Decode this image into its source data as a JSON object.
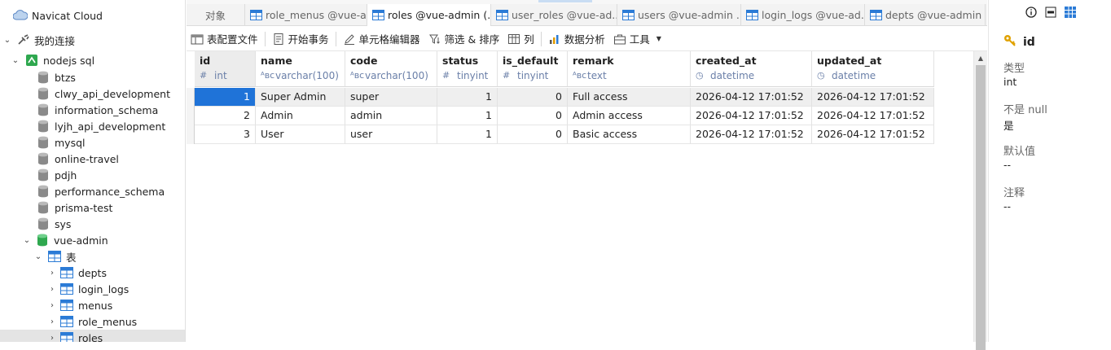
{
  "sidebar": {
    "app_title": "Navicat Cloud",
    "my_connections": "我的连接",
    "connection": "nodejs sql",
    "databases": [
      "btzs",
      "clwy_api_development",
      "information_schema",
      "lyjh_api_development",
      "mysql",
      "online-travel",
      "pdjh",
      "performance_schema",
      "prisma-test",
      "sys"
    ],
    "open_database": "vue-admin",
    "tables_folder": "表",
    "tables": [
      "depts",
      "login_logs",
      "menus",
      "role_menus",
      "roles"
    ]
  },
  "tabs": [
    {
      "label": "对象",
      "active": false,
      "icon": false
    },
    {
      "label": "role_menus @vue-a...",
      "active": false,
      "icon": true
    },
    {
      "label": "roles @vue-admin (...",
      "active": true,
      "icon": true
    },
    {
      "label": "user_roles @vue-ad...",
      "active": false,
      "icon": true
    },
    {
      "label": "users @vue-admin ...",
      "active": false,
      "icon": true
    },
    {
      "label": "login_logs @vue-ad...",
      "active": false,
      "icon": true
    },
    {
      "label": "depts @vue-admin ...",
      "active": false,
      "icon": true
    }
  ],
  "toolbar": {
    "table_config_file": "表配置文件",
    "begin_transaction": "开始事务",
    "cell_editor": "单元格编辑器",
    "filter_sort": "筛选 & 排序",
    "columns": "列",
    "data_analysis": "数据分析",
    "tools": "工具"
  },
  "grid": {
    "columns": [
      {
        "name": "id",
        "type": "int",
        "kind": "num"
      },
      {
        "name": "name",
        "type": "varchar(100)",
        "kind": "text"
      },
      {
        "name": "code",
        "type": "varchar(100)",
        "kind": "text"
      },
      {
        "name": "status",
        "type": "tinyint",
        "kind": "num"
      },
      {
        "name": "is_default",
        "type": "tinyint",
        "kind": "num"
      },
      {
        "name": "remark",
        "type": "text",
        "kind": "text"
      },
      {
        "name": "created_at",
        "type": "datetime",
        "kind": "date"
      },
      {
        "name": "updated_at",
        "type": "datetime",
        "kind": "date"
      }
    ],
    "rows": [
      [
        "1",
        "Super Admin",
        "super",
        "1",
        "0",
        "Full access",
        "2026-04-12 17:01:52",
        "2026-04-12 17:01:52"
      ],
      [
        "2",
        "Admin",
        "admin",
        "1",
        "0",
        "Admin access",
        "2026-04-12 17:01:52",
        "2026-04-12 17:01:52"
      ],
      [
        "3",
        "User",
        "user",
        "1",
        "0",
        "Basic access",
        "2026-04-12 17:01:52",
        "2026-04-12 17:01:52"
      ]
    ]
  },
  "inspector": {
    "field_name": "id",
    "type_label": "类型",
    "type_value": "int",
    "notnull_label": "不是 null",
    "notnull_value": "是",
    "default_label": "默认值",
    "default_value": "--",
    "comment_label": "注释",
    "comment_value": "--"
  },
  "colors": {
    "accent": "#1f73d8",
    "key_icon": "#e0a100",
    "db_open": "#2fa84f"
  }
}
